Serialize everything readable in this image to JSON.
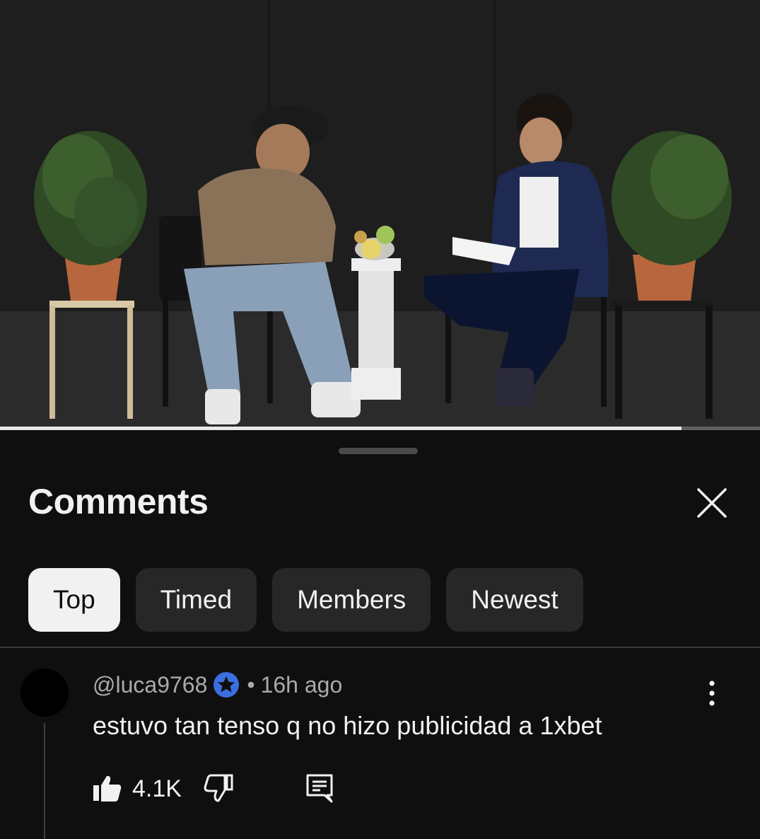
{
  "video": {
    "progress": 0.897
  },
  "comments_panel": {
    "title": "Comments",
    "close_icon": "close-icon",
    "sort_chips": [
      {
        "label": "Top",
        "selected": true
      },
      {
        "label": "Timed",
        "selected": false
      },
      {
        "label": "Members",
        "selected": false
      },
      {
        "label": "Newest",
        "selected": false
      }
    ]
  },
  "comment": {
    "author": "@luca9768",
    "badge_icon": "verified-star-icon",
    "separator": "•",
    "time": "16h ago",
    "text": "estuvo tan tenso q no hizo publicidad a 1xbet",
    "likes": "4.1K",
    "more_icon": "more-vert-icon",
    "like_icon": "thumbs-up-icon",
    "dislike_icon": "thumbs-down-icon",
    "reply_icon": "reply-icon"
  },
  "colors": {
    "background": "#0f0f0f",
    "chip": "#272727",
    "chip_active": "#f1f1f1",
    "text_primary": "#f1f1f1",
    "text_secondary": "#aaaaaa",
    "badge_blue": "#3b6fe0"
  }
}
